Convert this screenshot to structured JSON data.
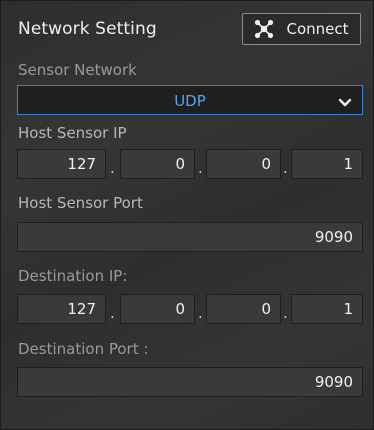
{
  "panel": {
    "title": "Network Setting",
    "connect_label": "Connect"
  },
  "sensor_network": {
    "label": "Sensor Network",
    "selected": "UDP"
  },
  "host_ip": {
    "label": "Host Sensor IP",
    "octets": [
      "127",
      "0",
      "0",
      "1"
    ],
    "separator": "."
  },
  "host_port": {
    "label": "Host Sensor Port",
    "value": "9090"
  },
  "dest_ip": {
    "label": "Destination IP:",
    "octets": [
      "127",
      "0",
      "0",
      "1"
    ],
    "separator": "."
  },
  "dest_port": {
    "label": "Destination Port :",
    "value": "9090"
  },
  "colors": {
    "accent": "#3d7fd0",
    "selected_text": "#5aa2f2",
    "panel_bg": "#2e2e2e",
    "field_bg": "#3a3a3a"
  },
  "icons": {
    "connect": "network-nodes-icon",
    "dropdown": "chevron-down-icon"
  }
}
